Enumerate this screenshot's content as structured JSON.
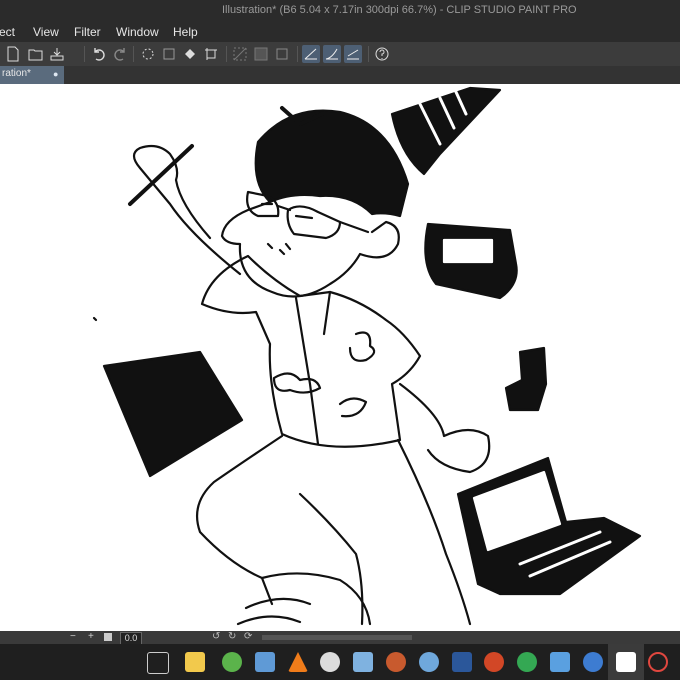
{
  "window": {
    "title": "Illustration* (B6 5.04 x 7.17in 300dpi 66.7%)  - CLIP STUDIO PAINT PRO"
  },
  "menu": [
    "ect",
    "View",
    "Filter",
    "Window",
    "Help"
  ],
  "toolbar": {
    "icons": [
      "new-file-icon",
      "open-folder-icon",
      "save-icon",
      "undo-icon",
      "redo-icon",
      "loading-spinner-icon",
      "clear-icon",
      "fill-icon",
      "transform-icon",
      "selection-off-icon",
      "selection-icon",
      "canvas-icon",
      "pen-stabilizer-icon",
      "curve-icon",
      "straight-line-icon",
      "help-icon"
    ]
  },
  "tab": {
    "label": "ration*",
    "close": "●"
  },
  "status": {
    "minus": "−",
    "plus": "+",
    "zoom": "0.0"
  },
  "taskbar": {
    "icons": [
      "task-view-icon",
      "file-explorer-icon",
      "utorrent-icon",
      "store-icon",
      "vlc-icon",
      "clock-icon",
      "camera-icon",
      "media-icon",
      "paint-icon",
      "word-icon",
      "powerpoint-icon",
      "chrome-icon",
      "window-icon",
      "globe-icon",
      "clip-studio-icon",
      "record-icon"
    ],
    "colors": [
      "#ffffff",
      "#f2c94c",
      "#5bb34b",
      "#5f9ad6",
      "#f07c1a",
      "#dcdcdc",
      "#7fb2e0",
      "#c85a2e",
      "#6fa8dc",
      "#2b579a",
      "#d24726",
      "#34a853",
      "#5aa0e0",
      "#3d7cd1",
      "#ffffff",
      "#e0473f"
    ]
  },
  "colors": {
    "accent": "#5a6b7d",
    "chrome": "#2b2b2b"
  }
}
